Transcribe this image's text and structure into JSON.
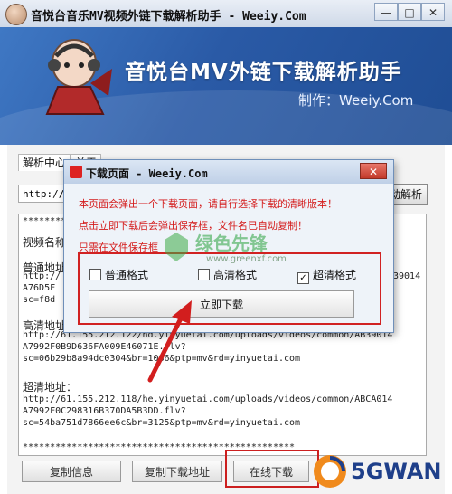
{
  "window": {
    "title": "音悦台音乐MV视频外链下载解析助手 - Weeiy.Com",
    "min_glyph": "—",
    "max_glyph": "□",
    "close_glyph": "✕"
  },
  "banner": {
    "title": "音悦台MV外链下载解析助手",
    "credit": "制作：Weeiy.Com"
  },
  "tabs": [
    "解析中心",
    "关于"
  ],
  "url_input": {
    "value": "http://"
  },
  "parse_button": "动解析",
  "results": {
    "separator": "**************************************************",
    "lines": [
      "视频名称",
      "普通地址",
      "http://",
      "A76D5F",
      "sc=f8d",
      "高清地址：",
      "http://61.155.212.122/hd.yinyuetai.com/uploads/videos/common/AB39014",
      "A7992F0B9D636FA009E46071E.flv?",
      "sc=06b29b8a94dc0304&br=1086&ptp=mv&rd=yinyuetai.com",
      "超清地址：",
      "http://61.155.212.118/he.yinyuetai.com/uploads/videos/common/ABCA014",
      "A7992F0C298316B370DA5B3DD.flv?",
      "sc=54ba751d7866ee6c&br=3125&ptp=mv&rd=yinyuetai.com"
    ],
    "right_fragments": [
      "39014"
    ]
  },
  "bottom_buttons": [
    "复制信息",
    "复制下载地址",
    "在线下载"
  ],
  "dialog": {
    "title": "下载页面 - Weeiy.Com",
    "close_glyph": "✕",
    "messages": [
      "本页面会弹出一个下载页面，请自行选择下载的清晰版本！",
      "点击立即下载后会弹出保存框，文件名已自动复制！",
      "只需在文件保存框"
    ],
    "options": [
      {
        "label": "普通格式",
        "checked": false
      },
      {
        "label": "高清格式",
        "checked": false
      },
      {
        "label": "超清格式",
        "checked": true
      }
    ],
    "check_glyph": "✓",
    "download_button": "立即下载"
  },
  "watermarks": {
    "greenxf": "绿色先锋",
    "greenxf_url": "www.greenxf.com",
    "fivegwan": "5GWAN"
  },
  "colors": {
    "banner_blue": "#2a5aa6",
    "alert_red": "#d41a1a",
    "annotation_red": "#cc1f1f"
  }
}
